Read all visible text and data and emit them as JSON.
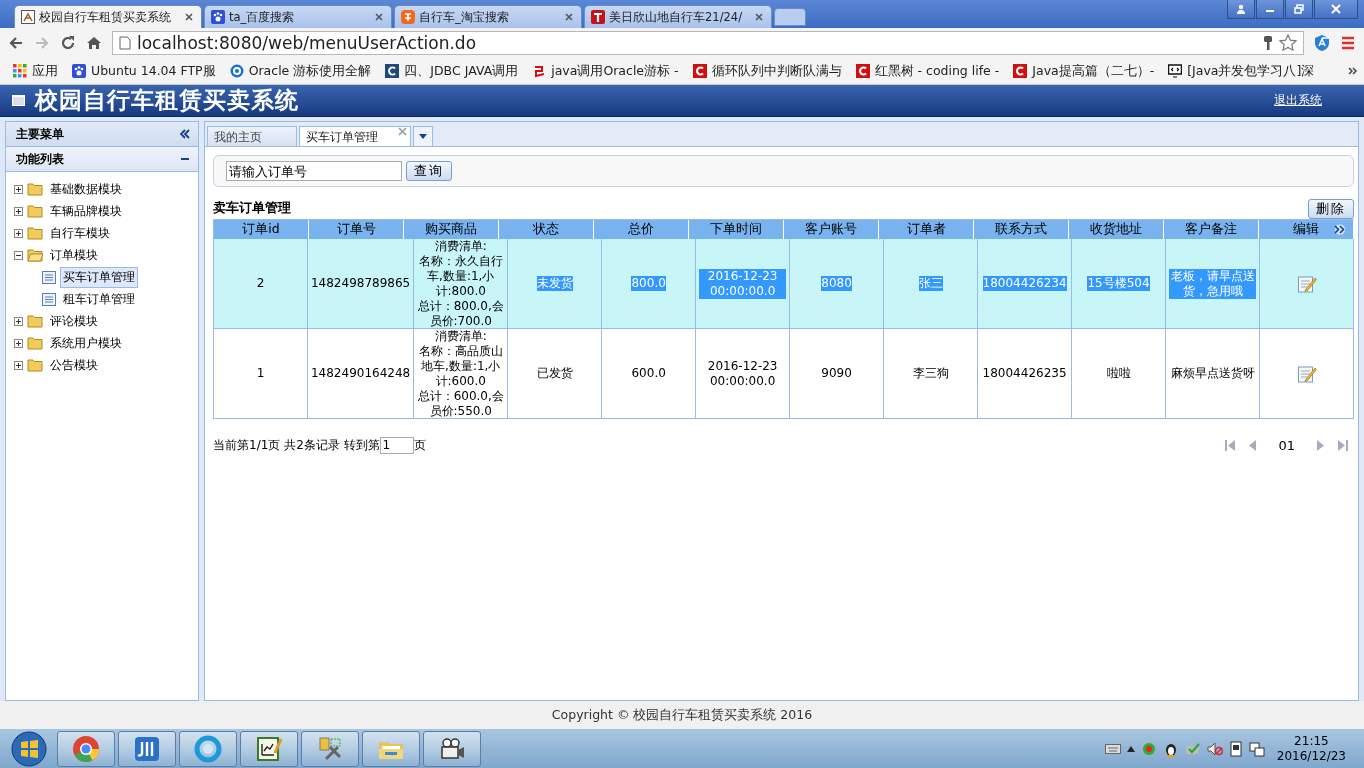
{
  "browser": {
    "tabs": [
      {
        "title": "校园自行车租赁买卖系统",
        "kind": "bike",
        "selected": true
      },
      {
        "title": "ta_百度搜索",
        "kind": "paw",
        "selected": false
      },
      {
        "title": "自行车_淘宝搜索",
        "kind": "taobao",
        "selected": false
      },
      {
        "title": "美日欣山地自行车21/24/",
        "kind": "t",
        "selected": false
      }
    ],
    "url": "localhost:8080/web/menuUserAction.do",
    "bookmarks": [
      {
        "label": "应用",
        "kind": "apps"
      },
      {
        "label": "Ubuntu 14.04 FTP服",
        "kind": "paw"
      },
      {
        "label": "Oracle 游标使用全解",
        "kind": "circle"
      },
      {
        "label": "四、JDBC JAVA调用",
        "kind": "c-blue"
      },
      {
        "label": "java调用Oracle游标 -",
        "kind": "yi"
      },
      {
        "label": "循环队列中判断队满与",
        "kind": "c-red"
      },
      {
        "label": "红黑树 - coding life -",
        "kind": "c-red"
      },
      {
        "label": "Java提高篇（二七）-",
        "kind": "c-red"
      },
      {
        "label": "[Java并发包学习八]深",
        "kind": "monitor"
      }
    ]
  },
  "app": {
    "title": "校园自行车租赁买卖系统",
    "logout": "退出系统"
  },
  "sidebar": {
    "title": "主要菜单",
    "section": "功能列表",
    "tree": [
      {
        "label": "基础数据模块",
        "expanded": false
      },
      {
        "label": "车辆品牌模块",
        "expanded": false
      },
      {
        "label": "自行车模块",
        "expanded": false
      },
      {
        "label": "订单模块",
        "expanded": true,
        "children": [
          {
            "label": "买车订单管理",
            "selected": true
          },
          {
            "label": "租车订单管理",
            "selected": false
          }
        ]
      },
      {
        "label": "评论模块",
        "expanded": false
      },
      {
        "label": "系统用户模块",
        "expanded": false
      },
      {
        "label": "公告模块",
        "expanded": false
      }
    ]
  },
  "content_tabs": [
    {
      "label": "我的主页",
      "selected": false,
      "closable": false
    },
    {
      "label": "买车订单管理",
      "selected": true,
      "closable": true
    }
  ],
  "search": {
    "placeholder": "请输入订单号",
    "button": "查询"
  },
  "section_title": "卖车订单管理",
  "delete_button": "删除",
  "table": {
    "columns": [
      "订单id",
      "订单号",
      "购买商品",
      "状态",
      "总价",
      "下单时间",
      "客户账号",
      "订单者",
      "联系方式",
      "收货地址",
      "客户备注",
      "编辑"
    ],
    "rows": [
      {
        "selected": true,
        "cells": [
          "2",
          "1482498789865",
          "消费清单:\n名称：永久自行车,数量:1,小计:800.0\n总计：800.0,会员价:700.0",
          "未发货",
          "800.0",
          "2016-12-23 00:00:00.0",
          "8080",
          "张三",
          "18004426234",
          "15号楼504",
          "老板，请早点送货，急用哦"
        ]
      },
      {
        "selected": false,
        "cells": [
          "1",
          "1482490164248",
          "消费清单:\n名称：高品质山地车,数量:1,小计:600.0\n总计：600.0,会员价:550.0",
          "已发货",
          "600.0",
          "2016-12-23 00:00:00.0",
          "9090",
          "李三狗",
          "18004426235",
          "啦啦",
          "麻烦早点送货呀"
        ]
      }
    ]
  },
  "pager": {
    "info": "当前第1/1页 共2条记录 转到第",
    "page_input": "1",
    "suffix": "页",
    "current": "01"
  },
  "footer": "Copyright © 校园自行车租赁买卖系统 2016",
  "taskbar": {
    "apps": [
      {
        "kind": "chrome"
      },
      {
        "kind": "ide"
      },
      {
        "kind": "ring"
      },
      {
        "kind": "chart"
      },
      {
        "kind": "tools"
      },
      {
        "kind": "folder"
      },
      {
        "kind": "camera"
      }
    ],
    "time": "21:15",
    "date": "2016/12/23"
  }
}
